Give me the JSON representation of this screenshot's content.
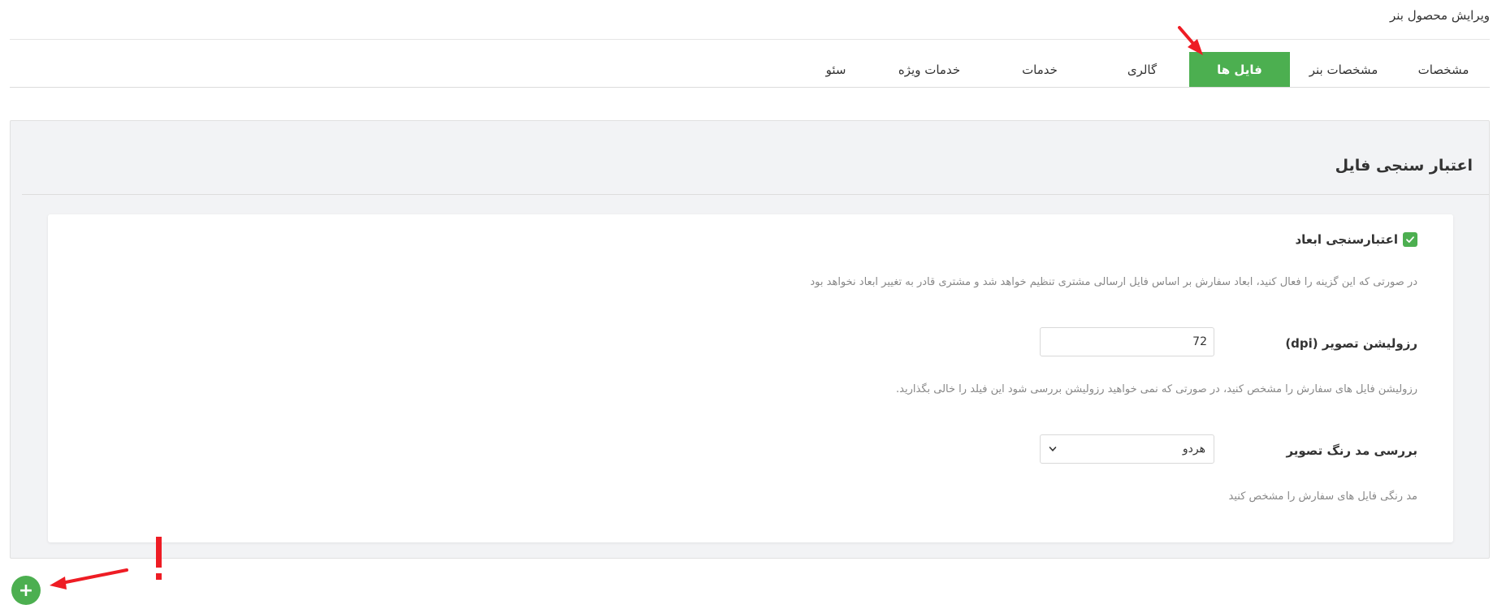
{
  "page": {
    "title": "ویرایش محصول بنر"
  },
  "tabs": [
    {
      "label": "مشخصات"
    },
    {
      "label": "مشخصات بنر"
    },
    {
      "label": "فایل ها",
      "active": true
    },
    {
      "label": "گالری"
    },
    {
      "label": "خدمات"
    },
    {
      "label": "خدمات ویژه"
    },
    {
      "label": "سئو"
    }
  ],
  "section": {
    "title": "اعتبار سنجی فایل"
  },
  "dimension_validation": {
    "label": "اعتبارسنجی ابعاد",
    "checked": true,
    "help": "در صورتی که این گزینه را فعال کنید، ابعاد سفارش بر اساس فایل ارسالی مشتری تنظیم خواهد شد و مشتری قادر به تغییر ابعاد نخواهد بود"
  },
  "resolution": {
    "label": "رزولیشن تصویر (dpi)",
    "value": "72",
    "help": "رزولیشن فایل های سفارش را مشخص کنید، در صورتی که نمی خواهید رزولیشن بررسی شود این فیلد را خالی بگذارید."
  },
  "color_mode": {
    "label": "بررسی مد رنگ تصویر",
    "selected": "هردو",
    "help": "مد رنگی فایل های سفارش را مشخص کنید"
  },
  "add_button": {
    "label": "+"
  },
  "colors": {
    "accent": "#4caf50",
    "annotation": "#ee1c24",
    "panel_bg": "#f2f3f5"
  },
  "icons": {
    "checkbox": "check-icon",
    "select": "chevron-down-icon"
  }
}
